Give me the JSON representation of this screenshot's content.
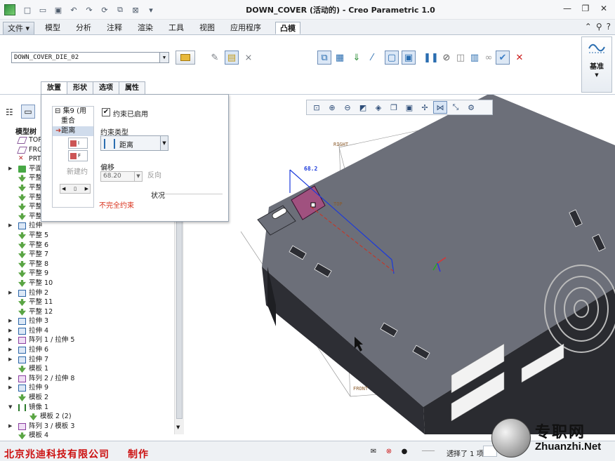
{
  "window": {
    "title": "DOWN_COVER (活动的) - Creo Parametric 1.0"
  },
  "menu": {
    "file": "文件",
    "tabs": [
      "模型",
      "分析",
      "注释",
      "渲染",
      "工具",
      "视图",
      "应用程序",
      "凸模"
    ]
  },
  "ribbon": {
    "die_combo": "DOWN_COVER_DIE_02",
    "datum_label": "基准"
  },
  "dashboard_tabs": [
    "放置",
    "形状",
    "选项",
    "属性"
  ],
  "placement": {
    "set_label": "集9 (用",
    "items": [
      "重合",
      "距离"
    ],
    "new_constraint": "新建约",
    "constraint_enabled": "约束已启用",
    "constraint_type_label": "约束类型",
    "constraint_type_value": "距离",
    "offset_label": "偏移",
    "offset_value": "68.20",
    "flip_label": "反向",
    "status_label": "状况",
    "status_value": "不完全约束"
  },
  "model_tree": {
    "label": "模型树",
    "rows": [
      {
        "text": "TOP",
        "icon": "plane",
        "indent": 1,
        "exp": ""
      },
      {
        "text": "FRO",
        "icon": "plane",
        "indent": 1,
        "exp": ""
      },
      {
        "text": "PRT",
        "icon": "csys",
        "indent": 1,
        "exp": ""
      },
      {
        "text": "平面",
        "icon": "flat",
        "indent": 1,
        "exp": "▶"
      },
      {
        "text": "平整",
        "icon": "mold",
        "indent": 1,
        "exp": ""
      },
      {
        "text": "平整",
        "icon": "mold",
        "indent": 1,
        "exp": ""
      },
      {
        "text": "平整",
        "icon": "mold",
        "indent": 1,
        "exp": ""
      },
      {
        "text": "平整",
        "icon": "mold",
        "indent": 1,
        "exp": ""
      },
      {
        "text": "平整",
        "icon": "mold",
        "indent": 1,
        "exp": ""
      },
      {
        "text": "拉伸",
        "icon": "extrude",
        "indent": 1,
        "exp": "▶"
      },
      {
        "text": "平整 5",
        "icon": "mold",
        "indent": 1,
        "exp": ""
      },
      {
        "text": "平整 6",
        "icon": "mold",
        "indent": 1,
        "exp": ""
      },
      {
        "text": "平整 7",
        "icon": "mold",
        "indent": 1,
        "exp": ""
      },
      {
        "text": "平整 8",
        "icon": "mold",
        "indent": 1,
        "exp": ""
      },
      {
        "text": "平整 9",
        "icon": "mold",
        "indent": 1,
        "exp": ""
      },
      {
        "text": "平整 10",
        "icon": "mold",
        "indent": 1,
        "exp": ""
      },
      {
        "text": "拉伸 2",
        "icon": "extrude",
        "indent": 1,
        "exp": "▶"
      },
      {
        "text": "平整 11",
        "icon": "mold",
        "indent": 1,
        "exp": ""
      },
      {
        "text": "平整 12",
        "icon": "mold",
        "indent": 1,
        "exp": ""
      },
      {
        "text": "拉伸 3",
        "icon": "extrude",
        "indent": 1,
        "exp": "▶"
      },
      {
        "text": "拉伸 4",
        "icon": "extrude",
        "indent": 1,
        "exp": "▶"
      },
      {
        "text": "阵列 1 / 拉伸 5",
        "icon": "pattern",
        "indent": 1,
        "exp": "▶"
      },
      {
        "text": "拉伸 6",
        "icon": "extrude",
        "indent": 1,
        "exp": "▶"
      },
      {
        "text": "拉伸 7",
        "icon": "extrude",
        "indent": 1,
        "exp": "▶"
      },
      {
        "text": "模板 1",
        "icon": "mold",
        "indent": 1,
        "exp": ""
      },
      {
        "text": "阵列 2 / 拉伸 8",
        "icon": "pattern",
        "indent": 1,
        "exp": "▶"
      },
      {
        "text": "拉伸 9",
        "icon": "extrude",
        "indent": 1,
        "exp": "▶"
      },
      {
        "text": "模板 2",
        "icon": "mold",
        "indent": 1,
        "exp": ""
      },
      {
        "text": "镜像 1",
        "icon": "mirror",
        "indent": 1,
        "exp": "▼"
      },
      {
        "text": "模板 2 (2)",
        "icon": "mold",
        "indent": 2,
        "exp": ""
      },
      {
        "text": "阵列 3 / 模板 3",
        "icon": "pattern",
        "indent": 1,
        "exp": "▶"
      },
      {
        "text": "模板 4",
        "icon": "mold",
        "indent": 1,
        "exp": ""
      }
    ]
  },
  "graphics": {
    "dim_value": "68.2",
    "labels": [
      "RIGHT",
      "TOP",
      "FRONT"
    ]
  },
  "statusbar": {
    "company": "北京兆迪科技有限公司",
    "make": "制作",
    "selection": "选择了 1 项"
  },
  "watermark": {
    "cn": "专职网",
    "en": "Zhuanzhi.Net"
  },
  "colors": {
    "accent": "#2a6db0",
    "status_error": "#d9301a",
    "company_red": "#cc1010",
    "model_gray": "#6c6f79"
  }
}
